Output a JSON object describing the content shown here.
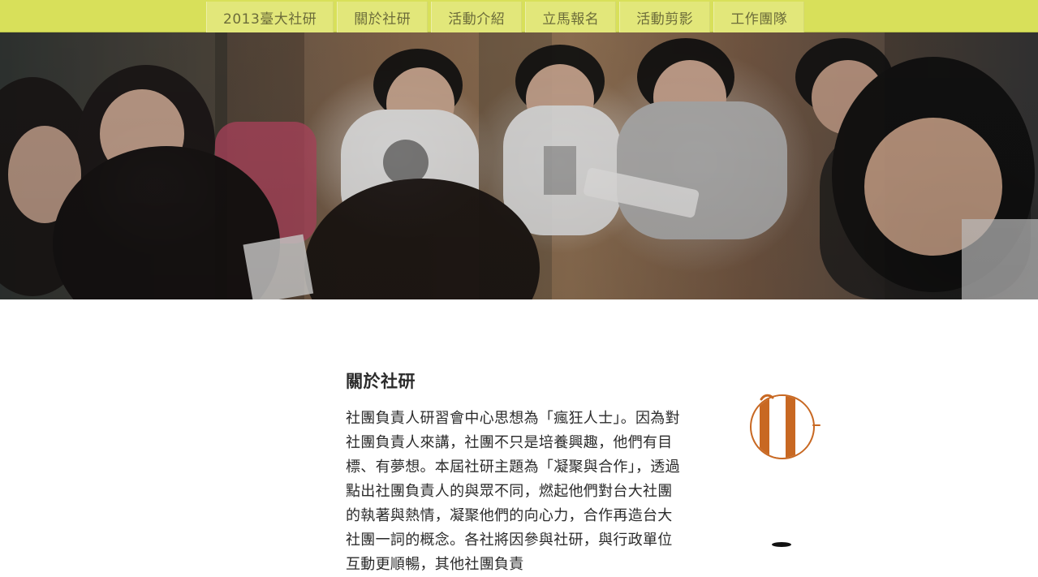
{
  "nav": {
    "items": [
      {
        "label": "2013臺大社研"
      },
      {
        "label": "關於社研"
      },
      {
        "label": "活動介紹"
      },
      {
        "label": "立馬報名"
      },
      {
        "label": "活動剪影"
      },
      {
        "label": "工作團隊"
      }
    ]
  },
  "hero": {
    "image_name": "students-group-photo"
  },
  "about": {
    "title": "關於社研",
    "body": "社團負責人研習會中心思想為「瘋狂人士」。因為對社團負責人來講，社團不只是培養興趣，他們有目標、有夢想。本屆社研主題為「凝聚與合作」，透過點出社團負責人的與眾不同，燃起他們對台大社團的執著與熱情，凝聚他們的向心力，合作再造台大社團一詞的概念。各社將因參與社研，與行政單位互動更順暢，其他社團負責"
  },
  "colors": {
    "topbar": "#d8e05a",
    "nav_button": "#e2e77a",
    "nav_text": "#6c6c3a",
    "logo_orange": "#c86822"
  },
  "icons": {
    "logo": "orange-striped-circle-icon"
  }
}
